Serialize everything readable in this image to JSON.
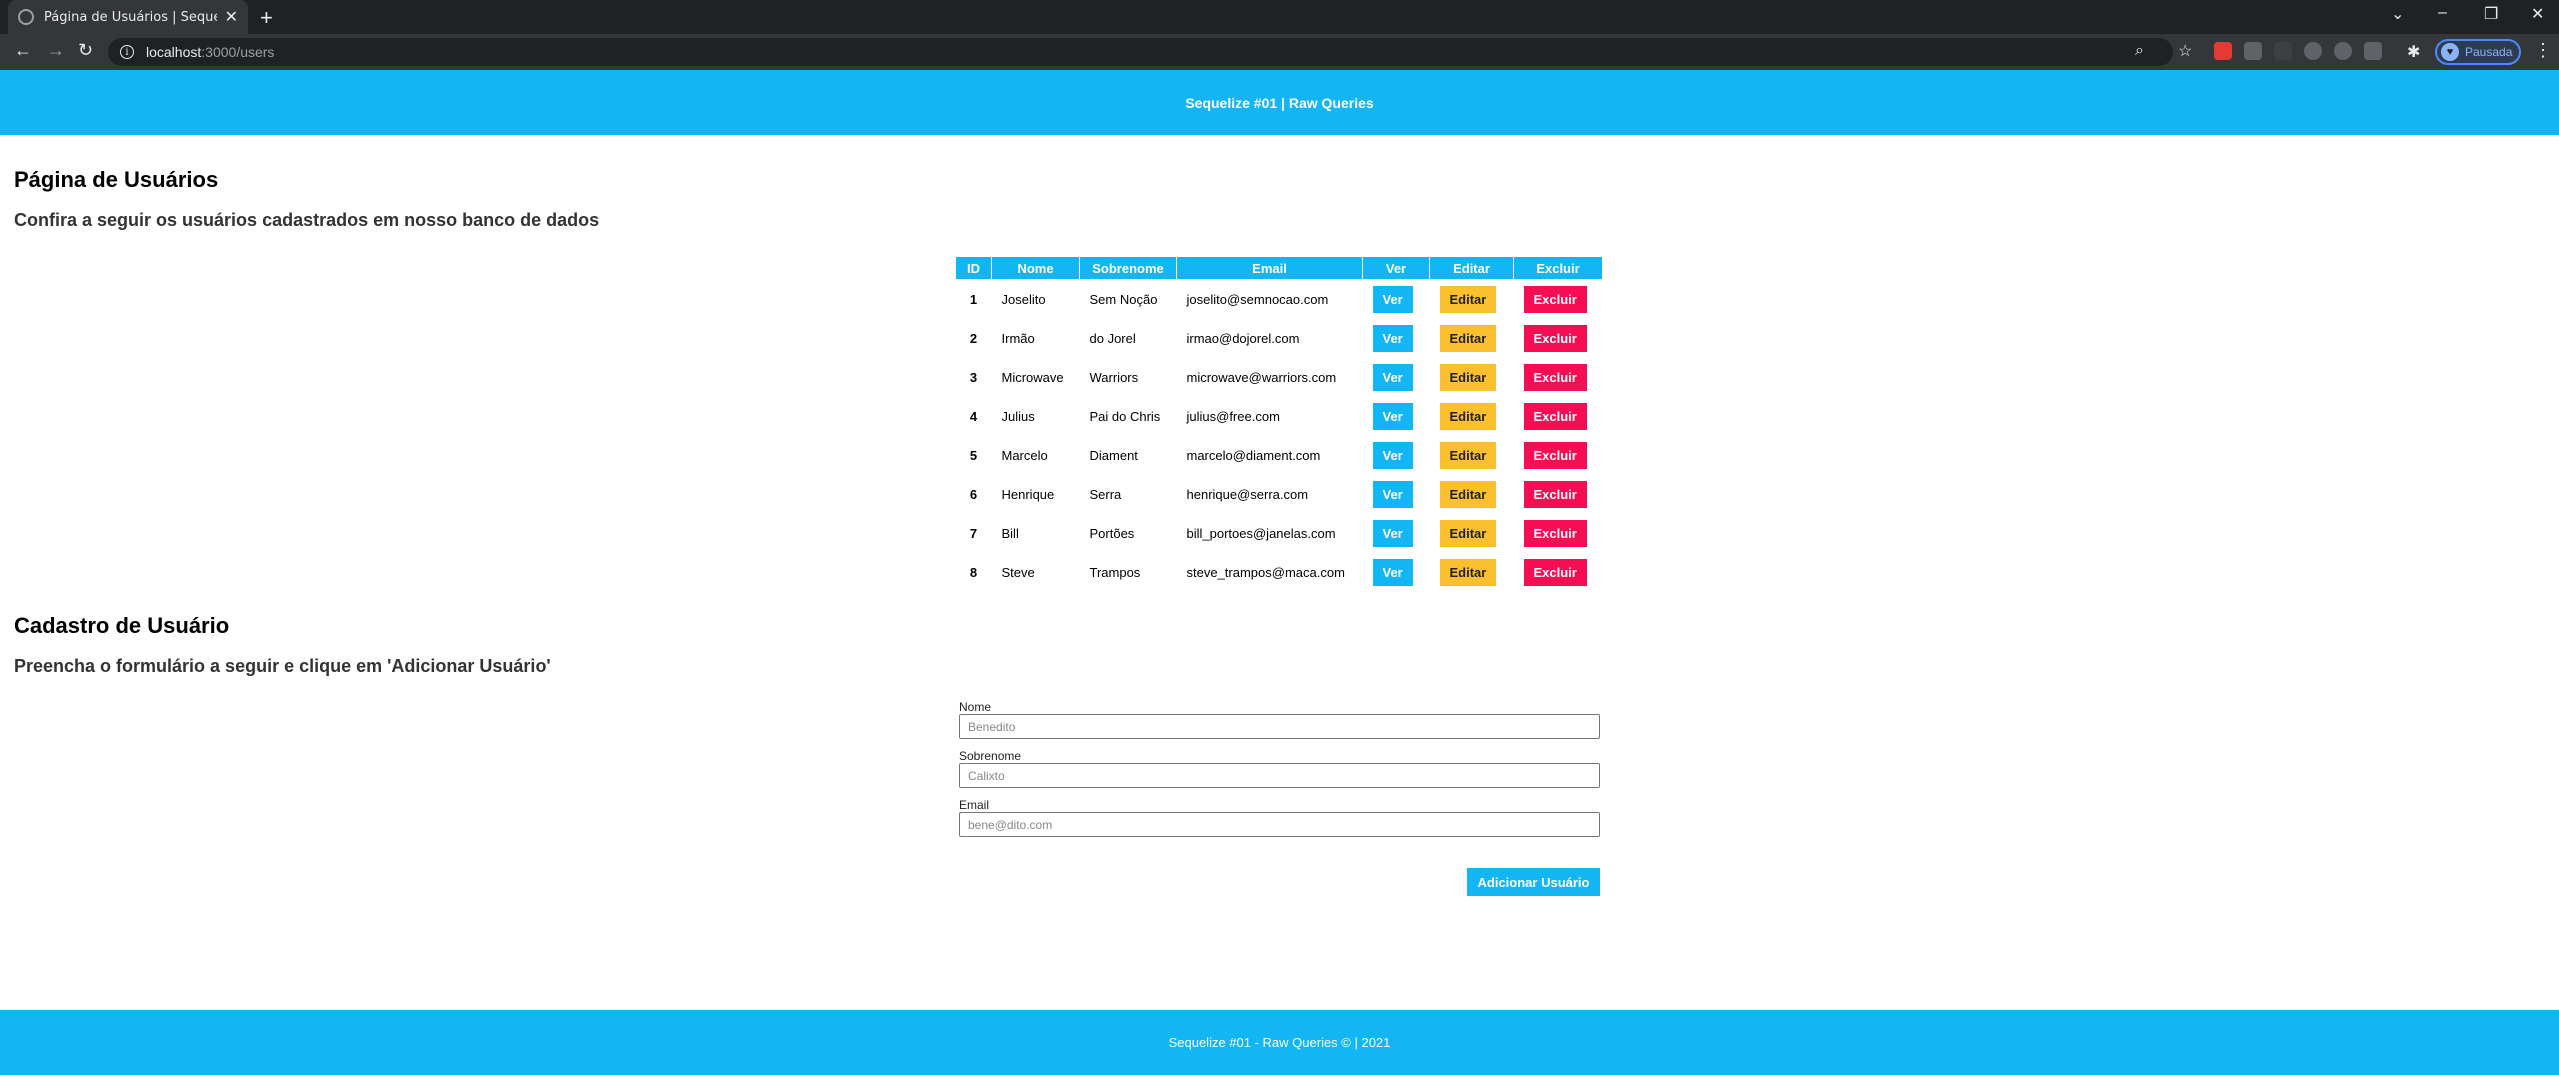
{
  "browser": {
    "tab_title": "Página de Usuários | Sequelize #0",
    "url_host": "localhost",
    "url_path": ":3000/users",
    "profile_label": "Pausada"
  },
  "header": {
    "title": "Sequelize #01 | Raw Queries"
  },
  "users_section": {
    "title": "Página de Usuários",
    "subtitle": "Confira a seguir os usuários cadastrados em nosso banco de dados"
  },
  "table": {
    "columns": [
      "ID",
      "Nome",
      "Sobrenome",
      "Email",
      "Ver",
      "Editar",
      "Excluir"
    ],
    "rows": [
      {
        "id": "1",
        "nome": "Joselito",
        "sobrenome": "Sem Noção",
        "email": "joselito@semnocao.com"
      },
      {
        "id": "2",
        "nome": "Irmão",
        "sobrenome": "do Jorel",
        "email": "irmao@dojorel.com"
      },
      {
        "id": "3",
        "nome": "Microwave",
        "sobrenome": "Warriors",
        "email": "microwave@warriors.com"
      },
      {
        "id": "4",
        "nome": "Julius",
        "sobrenome": "Pai do Chris",
        "email": "julius@free.com"
      },
      {
        "id": "5",
        "nome": "Marcelo",
        "sobrenome": "Diament",
        "email": "marcelo@diament.com"
      },
      {
        "id": "6",
        "nome": "Henrique",
        "sobrenome": "Serra",
        "email": "henrique@serra.com"
      },
      {
        "id": "7",
        "nome": "Bill",
        "sobrenome": "Portões",
        "email": "bill_portoes@janelas.com"
      },
      {
        "id": "8",
        "nome": "Steve",
        "sobrenome": "Trampos",
        "email": "steve_trampos@maca.com"
      }
    ],
    "ver_label": "Ver",
    "editar_label": "Editar",
    "excluir_label": "Excluir"
  },
  "form_section": {
    "title": "Cadastro de Usuário",
    "subtitle": "Preencha o formulário a seguir e clique em 'Adicionar Usuário'",
    "nome_label": "Nome",
    "nome_placeholder": "Benedito",
    "sobrenome_label": "Sobrenome",
    "sobrenome_placeholder": "Calixto",
    "email_label": "Email",
    "email_placeholder": "bene@dito.com",
    "submit_label": "Adicionar Usuário"
  },
  "footer": {
    "text": "Sequelize #01 - Raw Queries © | 2021"
  },
  "colors": {
    "brand": "#12b6f5",
    "edit": "#fcc02e",
    "delete": "#f50e54"
  }
}
